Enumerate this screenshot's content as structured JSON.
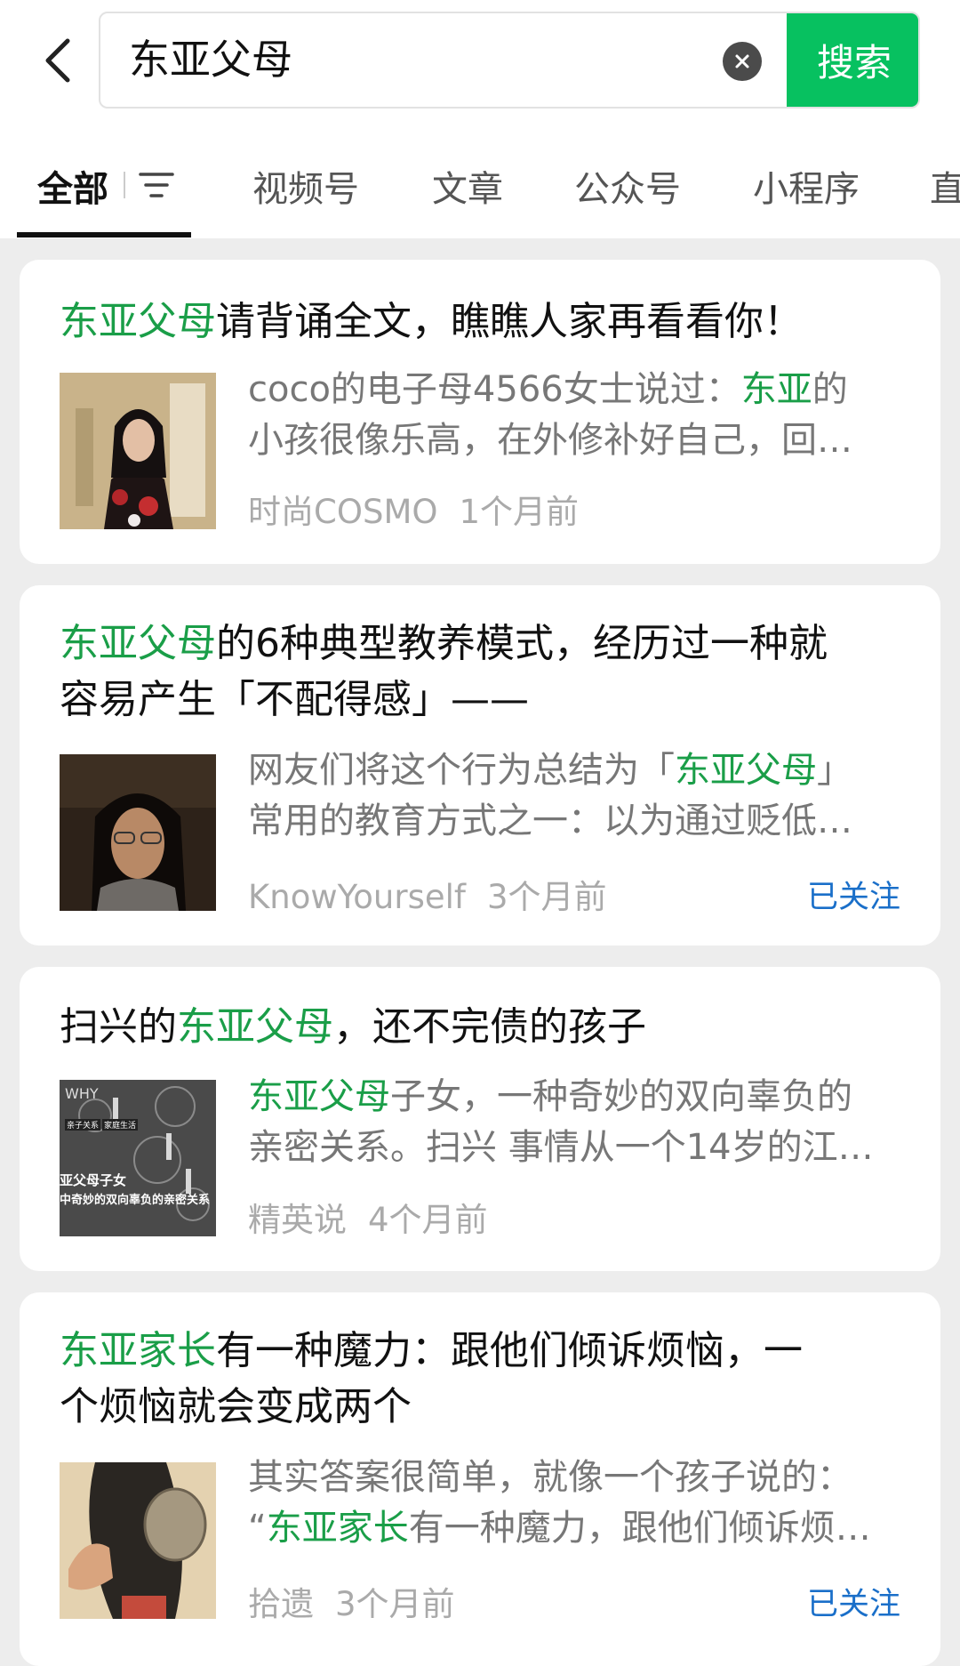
{
  "search": {
    "query": "东亚父母",
    "button_label": "搜索"
  },
  "tabs": [
    {
      "label": "全部"
    },
    {
      "label": "视频号"
    },
    {
      "label": "文章"
    },
    {
      "label": "公众号"
    },
    {
      "label": "小程序"
    },
    {
      "label": "直"
    }
  ],
  "results": [
    {
      "title_hl": "东亚父母",
      "title_rest": "请背诵全文，瞧瞧人家再看看你！",
      "snippet_line1_pre": "coco的电子母4566女士说过：",
      "snippet_line1_hl": "东亚",
      "snippet_line1_post": "的",
      "snippet_line2": "小孩很像乐高，在外修补好自己，回…",
      "source": "时尚COSMO",
      "time": "1个月前"
    },
    {
      "title_hl": "东亚父母",
      "title_rest_line1": "的6种典型教养模式，经历过一种就",
      "title_line2": "容易产生「不配得感」——",
      "snippet_line1_pre": "网友们将这个行为总结为「",
      "snippet_line1_hl": "东亚父母",
      "snippet_line1_post": "」",
      "snippet_line2": "常用的教育方式之一：以为通过贬低…",
      "source": "KnowYourself",
      "time": "3个月前",
      "followed": "已关注"
    },
    {
      "title_pre": "扫兴的",
      "title_hl": "东亚父母",
      "title_post": "，还不完债的孩子",
      "snippet_line1_hl": "东亚父母",
      "snippet_line1_post": "子女，一种奇妙的双向辜负的",
      "snippet_line2": "亲密关系。扫兴 事情从一个14岁的江…",
      "source": "精英说",
      "time": "4个月前",
      "thumb_text": "WHY",
      "thumb_tag1": "亲子关系",
      "thumb_tag2": "家庭生活",
      "thumb_caption1": "亚父母子女",
      "thumb_caption2": "中奇妙的双向辜负的亲密关系"
    },
    {
      "title_hl": "东亚家长",
      "title_rest_line1": "有一种魔力：跟他们倾诉烦恼，一",
      "title_line2": "个烦恼就会变成两个",
      "snippet_line1": "其实答案很简单，就像一个孩子说的：",
      "snippet_line2_pre": "“",
      "snippet_line2_hl": "东亚家长",
      "snippet_line2_post": "有一种魔力，跟他们倾诉烦…",
      "source": "拾遗",
      "time": "3个月前",
      "followed": "已关注"
    }
  ],
  "colors": {
    "accent": "#07c160",
    "highlight": "#1a9e48",
    "link": "#1a6fc9",
    "background": "#ededed"
  },
  "icons": [
    "back-arrow-icon",
    "clear-icon",
    "filter-icon"
  ]
}
